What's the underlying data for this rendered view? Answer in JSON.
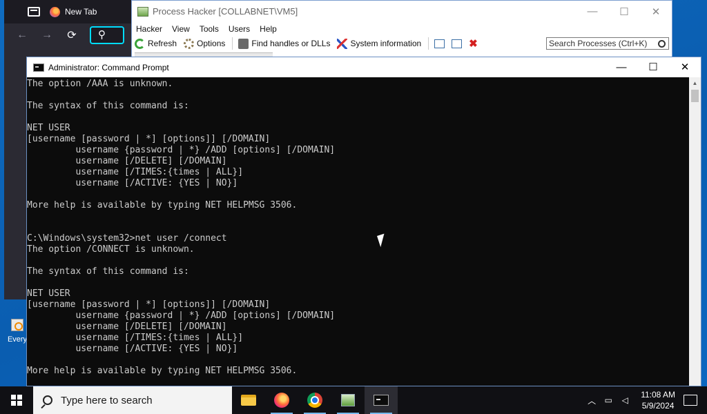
{
  "firefox": {
    "tab_title": "New Tab",
    "nav": {
      "back": "←",
      "forward": "→",
      "reload": "⟳",
      "search": "⚲"
    }
  },
  "process_hacker": {
    "title": "Process Hacker [COLLABNET\\VM5]",
    "menu": [
      "Hacker",
      "View",
      "Tools",
      "Users",
      "Help"
    ],
    "toolbar": {
      "refresh": "Refresh",
      "options": "Options",
      "find_handles": "Find handles or DLLs",
      "system_information": "System information"
    },
    "search_placeholder": "Search Processes (Ctrl+K)",
    "window_controls": {
      "minimize": "—",
      "maximize": "☐",
      "close": "✕"
    }
  },
  "cmd": {
    "title": "Administrator: Command Prompt",
    "window_controls": {
      "minimize": "—",
      "maximize": "☐",
      "close": "✕"
    },
    "lines": [
      "The option /AAA is unknown.",
      "",
      "The syntax of this command is:",
      "",
      "NET USER",
      "[username [password | *] [options]] [/DOMAIN]",
      "         username {password | *} /ADD [options] [/DOMAIN]",
      "         username [/DELETE] [/DOMAIN]",
      "         username [/TIMES:{times | ALL}]",
      "         username [/ACTIVE: {YES | NO}]",
      "",
      "More help is available by typing NET HELPMSG 3506.",
      "",
      "",
      "C:\\Windows\\system32>net user /connect",
      "The option /CONNECT is unknown.",
      "",
      "The syntax of this command is:",
      "",
      "NET USER",
      "[username [password | *] [options]] [/DOMAIN]",
      "         username {password | *} /ADD [options] [/DOMAIN]",
      "         username [/DELETE] [/DOMAIN]",
      "         username [/TIMES:{times | ALL}]",
      "         username [/ACTIVE: {YES | NO}]",
      "",
      "More help is available by typing NET HELPMSG 3506."
    ]
  },
  "desktop": {
    "icon_label": "Every"
  },
  "taskbar": {
    "search_placeholder": "Type here to search",
    "apps": [
      "file-explorer",
      "firefox",
      "chrome",
      "process-hacker",
      "command-prompt"
    ],
    "time": "11:08 AM",
    "date": "5/9/2024"
  }
}
